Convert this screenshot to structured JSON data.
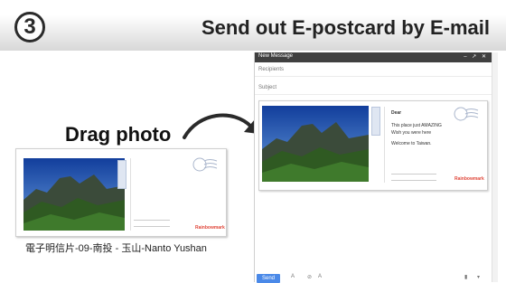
{
  "header": {
    "step_number": "3",
    "title": "Send out E-postcard by E-mail"
  },
  "left": {
    "drag_label": "Drag photo",
    "caption": "電子明信片-09-南投 - 玉山-Nanto Yushan",
    "postcard": {
      "brand": "Rainbowmark"
    }
  },
  "compose": {
    "window_title": "New Message",
    "window_controls": "– ↗ ✕",
    "recipients_placeholder": "Recipients",
    "subject_placeholder": "Subject",
    "send_label": "Send",
    "postcard": {
      "line1": "Dear",
      "line2": "This place just AMAZING",
      "line3": "Wish you were here",
      "line4": "Welcome to Taiwan.",
      "brand": "Rainbowmark"
    }
  },
  "colors": {
    "sky": "#1e4fa8",
    "mountain": "#2f4a22",
    "send_button": "#4a89e8",
    "brand": "#e0473a"
  }
}
